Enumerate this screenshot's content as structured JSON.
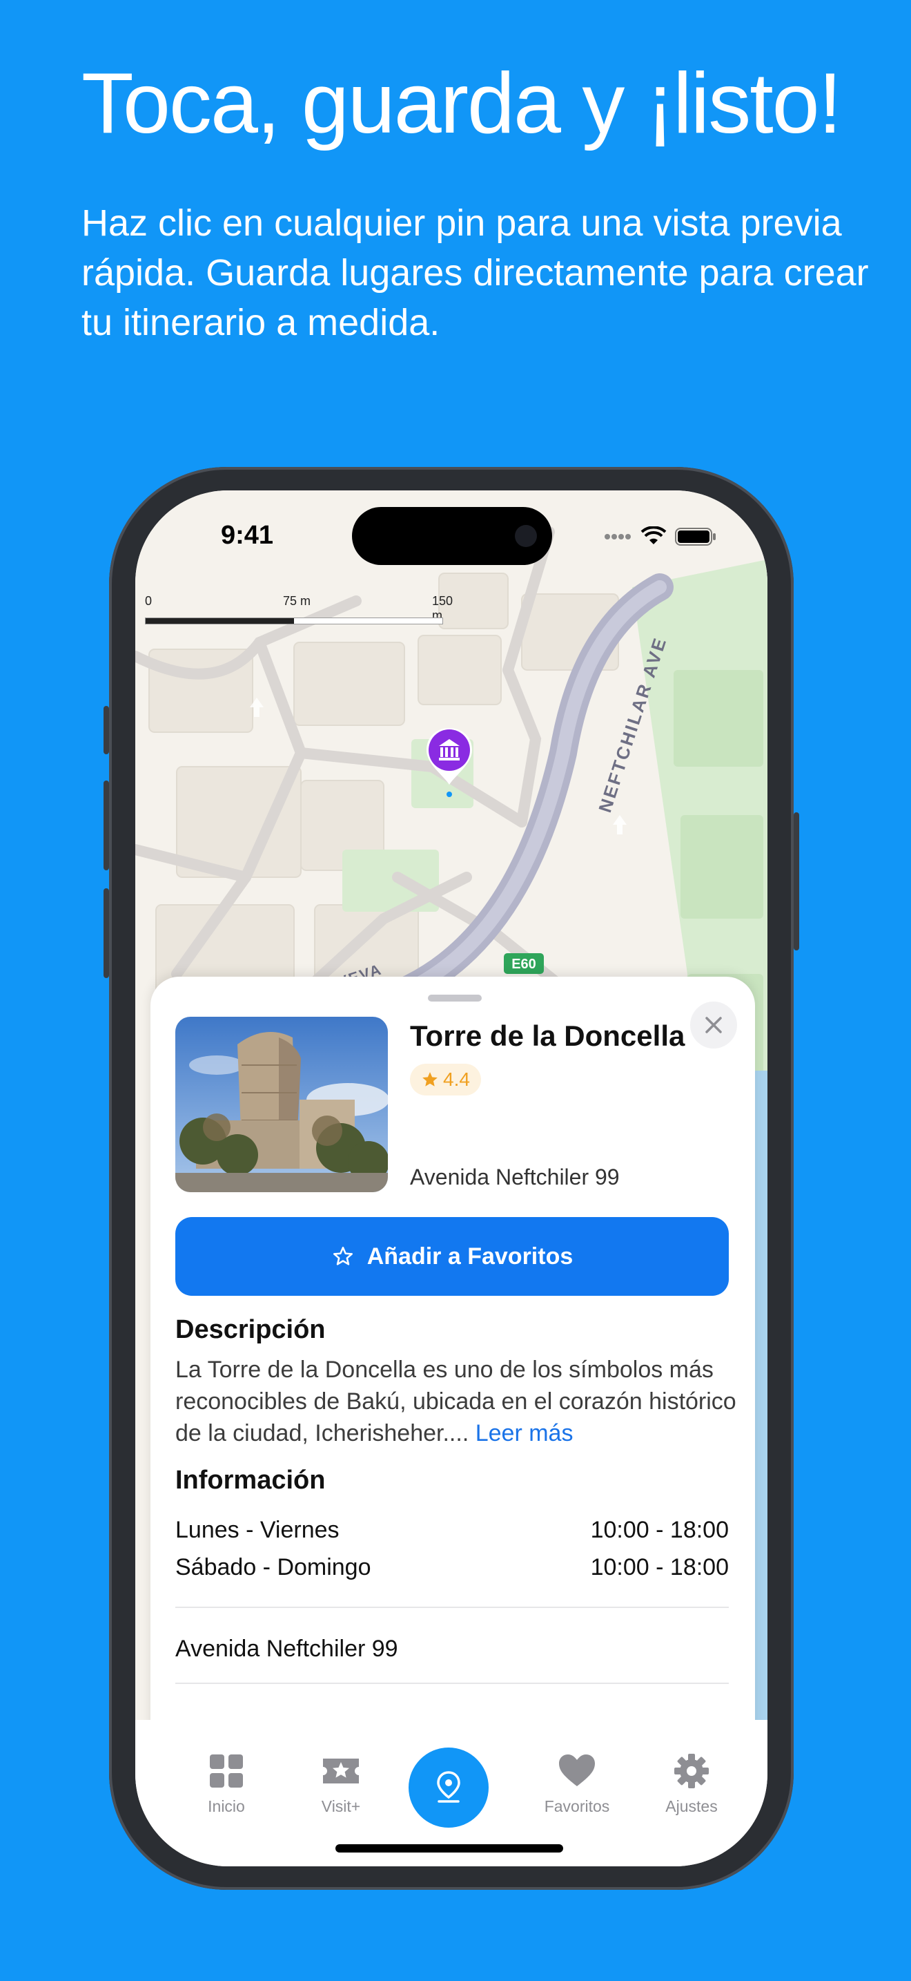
{
  "headline": "Toca, guarda y ¡listo!",
  "subtitle": "Haz clic en cualquier pin para una vista previa rápida. Guarda lugares directamente para crear tu itinerario a medida.",
  "status_bar": {
    "time": "9:41"
  },
  "map": {
    "scale_labels": [
      "0",
      "75 m",
      "150 m"
    ],
    "street_label": "NEFTCHILAR AVE",
    "road_badge": "E60",
    "partial_street_label": "VEVA"
  },
  "place": {
    "name": "Torre de la Doncella",
    "rating": "4.4",
    "address": "Avenida Neftchiler 99",
    "favorite_button": "Añadir a Favoritos",
    "description_heading": "Descripción",
    "description_text": "La Torre de la Doncella es uno de los símbolos más reconocibles de Bakú, ubicada en el corazón histórico de la ciudad, Icherisheher....",
    "read_more": "Leer más",
    "info_heading": "Información",
    "hours": [
      {
        "days": "Lunes - Viernes",
        "time": "10:00 - 18:00"
      },
      {
        "days": "Sábado - Domingo",
        "time": "10:00 - 18:00"
      }
    ],
    "address_info": "Avenida Neftchiler 99"
  },
  "tabbar": {
    "items": [
      {
        "label": "Inicio",
        "icon": "grid-icon"
      },
      {
        "label": "Visit+",
        "icon": "ticket-star-icon"
      },
      {
        "label": "",
        "icon": "map-pin-icon"
      },
      {
        "label": "Favoritos",
        "icon": "heart-icon"
      },
      {
        "label": "Ajustes",
        "icon": "gear-icon"
      }
    ]
  },
  "colors": {
    "background": "#1196F7",
    "primary_button": "#1278F0",
    "pin": "#8a2be2",
    "rating": "#f0a020"
  }
}
